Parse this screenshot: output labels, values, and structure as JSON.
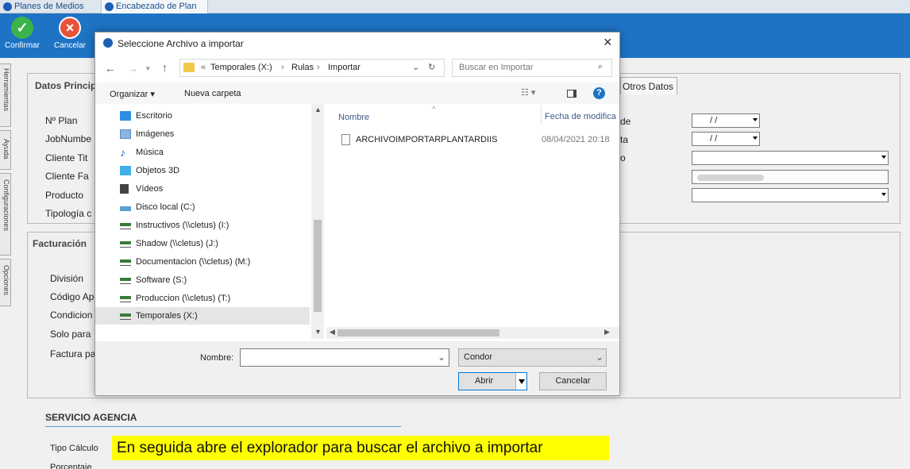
{
  "doc_tabs": [
    {
      "label": "Planes de Medios"
    },
    {
      "label": "Encabezado de Plan"
    }
  ],
  "ribbon": {
    "confirm_label": "Confirmar",
    "cancel_label": "Cancelar"
  },
  "side_tabs": [
    "Herramientas",
    "Ayuda",
    "Configuraciones",
    "Opciones"
  ],
  "form": {
    "datos_principales_tab": "Datos Princip",
    "otros_datos_tab": "Otros Datos",
    "labels": [
      "Nº Plan",
      "JobNumbe",
      "Cliente Tit",
      "Cliente Fa",
      "Producto",
      "Tipología c"
    ],
    "right_labels": [
      "de",
      "ta",
      "o"
    ],
    "date1": "/ /",
    "date2": "/ /",
    "facturacion_title": "Facturación",
    "fact_labels": [
      "División",
      "Código Ap",
      "Condicion",
      "Solo para",
      "Factura pa"
    ],
    "servicio_title": "SERVICIO AGENCIA",
    "tipo_calculo_label": "Tipo Cálculo",
    "porcentaje_label": "Porcentaje"
  },
  "dialog": {
    "title": "Seleccione Archivo a importar",
    "close": "×",
    "path": [
      "«",
      "Temporales (X:)",
      "›",
      "Rulas",
      "›",
      "Importar"
    ],
    "search_placeholder": "Buscar en Importar",
    "organize": "Organizar ▾",
    "new_folder": "Nueva carpeta",
    "col_name": "Nombre",
    "col_date": "Fecha de modifica",
    "tree": [
      {
        "label": "Escritorio",
        "icon": "desktop-icon",
        "color": "#2d8fe0"
      },
      {
        "label": "Imágenes",
        "icon": "pictures-icon",
        "color": "#5a8fc6"
      },
      {
        "label": "Música",
        "icon": "music-icon",
        "color": "#1a5fb4"
      },
      {
        "label": "Objetos 3D",
        "icon": "3d-objects-icon",
        "color": "#3fb0e8"
      },
      {
        "label": "Vídeos",
        "icon": "videos-icon",
        "color": "#444"
      },
      {
        "label": "Disco local (C:)",
        "icon": "drive-icon",
        "color": "#5aa0d0"
      },
      {
        "label": "Instructivos (\\\\cletus) (I:)",
        "icon": "network-drive-icon",
        "color": "#3a7a3a"
      },
      {
        "label": "Shadow (\\\\cletus) (J:)",
        "icon": "network-drive-icon",
        "color": "#3a7a3a"
      },
      {
        "label": "Documentacion (\\\\cletus) (M:)",
        "icon": "network-drive-icon",
        "color": "#3a7a3a"
      },
      {
        "label": "Software (S:)",
        "icon": "network-drive-icon",
        "color": "#3a7a3a"
      },
      {
        "label": "Produccion (\\\\cletus) (T:)",
        "icon": "network-drive-icon",
        "color": "#3a7a3a"
      },
      {
        "label": "Temporales (X:)",
        "icon": "network-drive-icon",
        "color": "#3a7a3a"
      }
    ],
    "files": [
      {
        "name": "ARCHIVOIMPORTARPLANTARDIIS",
        "date": "08/04/2021 20:18"
      }
    ],
    "filename_label": "Nombre:",
    "filename_value": "",
    "filter_value": "Condor",
    "open": "Abrir",
    "cancel": "Cancelar"
  },
  "annotation": "En seguida abre el explorador para buscar el archivo a importar",
  "colors": {
    "ribbon": "#1e73c4",
    "confirm": "#3bb54a",
    "cancel": "#e8533a",
    "highlight": "#ffff00"
  }
}
